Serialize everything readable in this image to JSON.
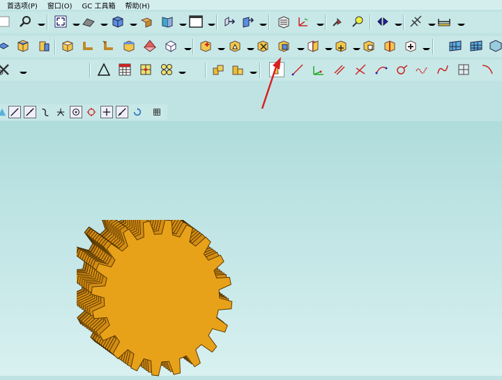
{
  "menubar": {
    "items": [
      "首选项(P)",
      "窗口(O)",
      "GC 工具箱",
      "帮助(H)"
    ]
  },
  "colors": {
    "toolbar_bg": "#c8e8e8",
    "viewport_bg": "#bfe3e3",
    "gear_fill": "#e8a21a",
    "arrow": "#d82020"
  },
  "icons": {
    "row1": [
      "search-icon",
      "fit-view-icon",
      "render-style-icon",
      "shaded-cube-icon",
      "layer-icon",
      "view-icon",
      "rectangle-icon",
      "extrude-icon",
      "revolve-icon",
      "part-navigator-icon",
      "datum-csys-icon",
      "curve-tool-icon",
      "wave-icon",
      "mirror-icon",
      "hatch-icon",
      "measure-icon"
    ],
    "row2": [
      "box-icon",
      "cylinder-icon",
      "cone-icon",
      "block-icon",
      "bend-icon",
      "flange-icon",
      "unfold-icon",
      "sphere-icon",
      "edge-blend-icon",
      "chamfer-icon",
      "subtract-icon",
      "synchronous-icon",
      "trim-body-icon",
      "split-body-icon",
      "offset-face-icon",
      "pattern-icon",
      "combine-icon",
      "through-curves-icon",
      "surface-icon"
    ],
    "row3": [
      "delete-curve-icon",
      "triangle-icon",
      "table-icon",
      "grid-icon",
      "symbol-icon",
      "assembly-add-icon",
      "assembly-new-icon",
      "point-icon",
      "line-icon",
      "datum-axis-icon",
      "offset-line-icon",
      "intersect-icon",
      "arc-icon",
      "spline-icon",
      "helix-icon",
      "bridge-curve-icon",
      "project-curve-icon",
      "extract-curve-icon"
    ],
    "snap": [
      "line-snap-icon",
      "tangent-snap-icon",
      "curve-snap-icon",
      "intersection-snap-icon",
      "center-snap-icon",
      "quadrant-snap-icon",
      "point-snap-icon",
      "angle-snap-icon",
      "rotate-snap-icon",
      "grid-snap-icon"
    ]
  }
}
